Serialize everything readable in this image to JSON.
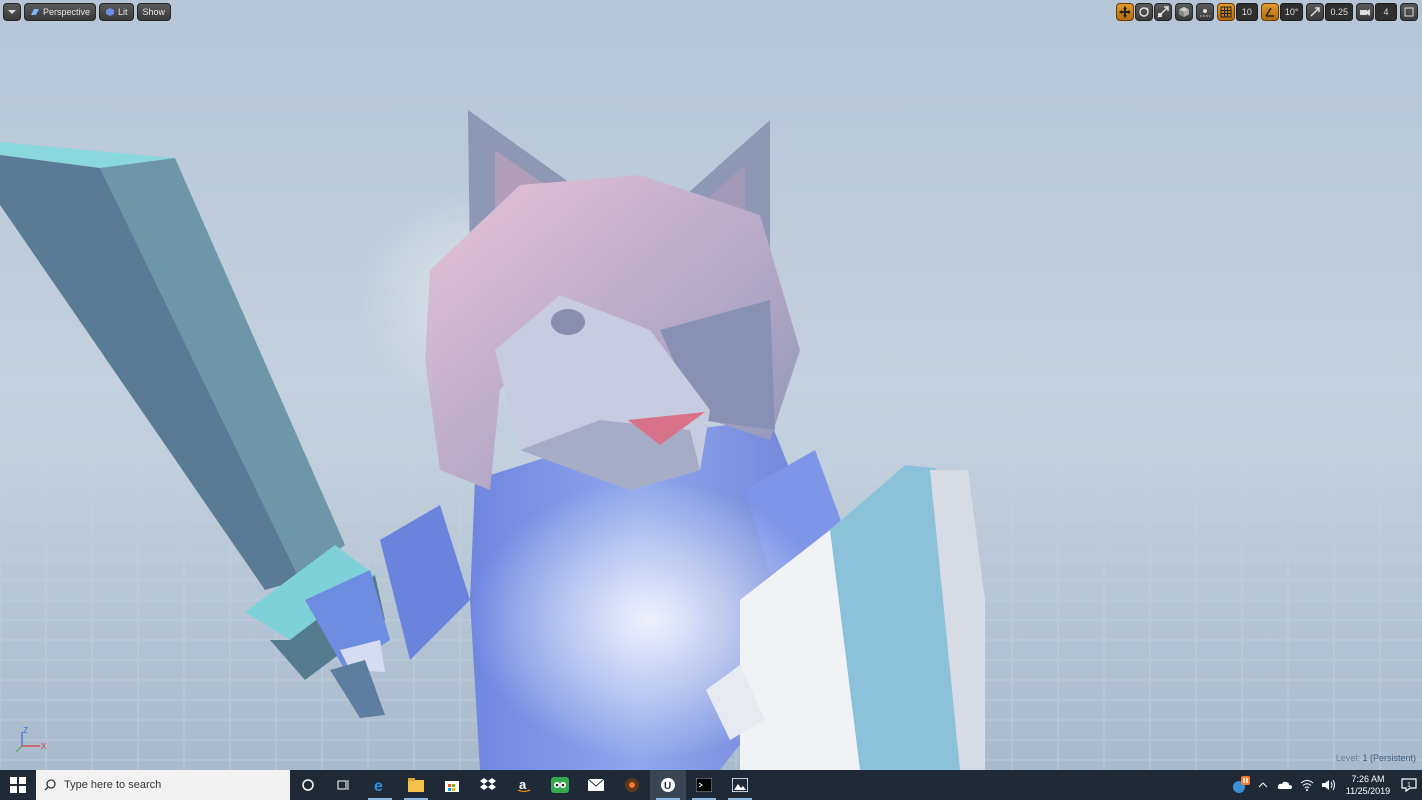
{
  "viewport": {
    "menu_icon": "chevron-down-icon",
    "perspective_label": "Perspective",
    "lit_label": "Lit",
    "show_label": "Show",
    "grid_snap_value": "10",
    "rotation_snap_value": "10°",
    "scale_snap_value": "0.25",
    "camera_speed_value": "4",
    "level_prefix": "Level:",
    "level_name": "1 (Persistent)",
    "axis_z": "Z",
    "axis_x": "X",
    "accent_color": "#e29a2a"
  },
  "taskbar": {
    "search_placeholder": "Type here to search",
    "time": "7:26 AM",
    "date": "11/25/2019",
    "notification_count": "1",
    "apps": [
      "cortana-icon",
      "task-view-icon",
      "edge-icon",
      "file-explorer-icon",
      "store-icon",
      "dropbox-icon",
      "amazon-icon",
      "tripadvisor-icon",
      "mail-icon",
      "blender-icon",
      "unreal-engine-icon",
      "terminal-icon",
      "photos-icon"
    ],
    "tray_icons": [
      "app-badge-icon",
      "chevron-up-icon",
      "onedrive-icon",
      "wifi-icon",
      "volume-icon"
    ]
  }
}
